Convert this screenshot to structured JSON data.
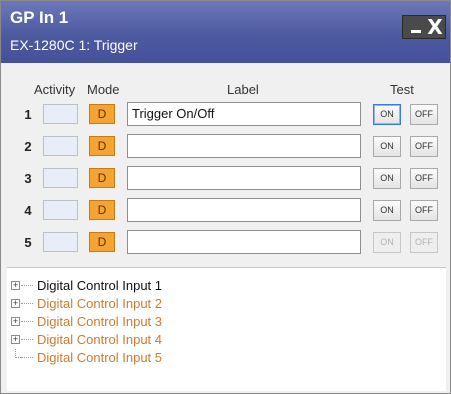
{
  "window": {
    "title": "GP In 1",
    "subtitle": "EX-1280C 1: Trigger",
    "close_glyph": "X"
  },
  "headers": {
    "activity": "Activity",
    "mode": "Mode",
    "label": "Label",
    "test": "Test"
  },
  "rows": [
    {
      "num": "1",
      "mode": "D",
      "label": "Trigger On/Off",
      "on": "ON",
      "off": "OFF"
    },
    {
      "num": "2",
      "mode": "D",
      "label": "",
      "on": "ON",
      "off": "OFF"
    },
    {
      "num": "3",
      "mode": "D",
      "label": "",
      "on": "ON",
      "off": "OFF"
    },
    {
      "num": "4",
      "mode": "D",
      "label": "",
      "on": "ON",
      "off": "OFF"
    },
    {
      "num": "5",
      "mode": "D",
      "label": "",
      "on": "ON",
      "off": "OFF"
    }
  ],
  "tree": [
    {
      "label": "Digital Control Input 1",
      "expander": "+",
      "color": "#111111"
    },
    {
      "label": "Digital Control Input 2",
      "expander": "+",
      "color": "#d27a2c"
    },
    {
      "label": "Digital Control Input 3",
      "expander": "+",
      "color": "#d27a2c"
    },
    {
      "label": "Digital Control Input 4",
      "expander": "+",
      "color": "#d27a2c"
    },
    {
      "label": "Digital Control Input 5",
      "expander": "",
      "color": "#d27a2c"
    }
  ],
  "colors": {
    "titlebar": "#4d5a9f",
    "mode_button": "#f6a431",
    "tree_inactive_text": "#d27a2c"
  }
}
